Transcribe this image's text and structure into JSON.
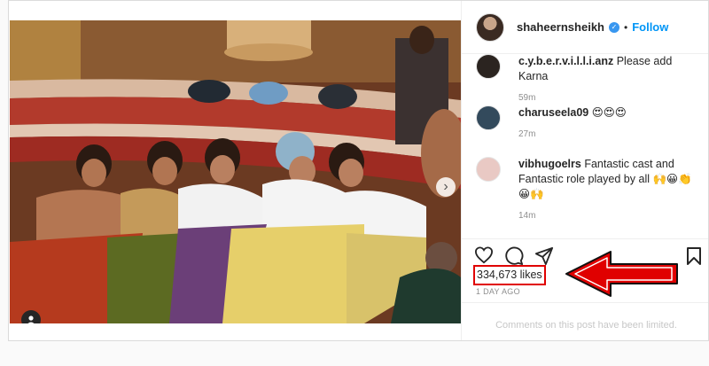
{
  "post": {
    "username": "shaheernsheikh",
    "separator": "•",
    "follow_label": "Follow",
    "verified_glyph": "✓"
  },
  "comments": [
    {
      "username": "c.y.b.e.r.v.i.l.l.i.anz",
      "text": "Please add Karna",
      "time": "59m",
      "avatar_color": "#2b2420"
    },
    {
      "username": "charuseela09",
      "text": "😍😍😍",
      "time": "27m",
      "avatar_color": "#334a5c"
    },
    {
      "username": "vibhugoelrs",
      "text": "Fantastic cast and Fantastic role played by all 🙌😀👏😀🙌",
      "time": "14m",
      "avatar_color": "#e9c9c4"
    }
  ],
  "actions": {
    "icons": [
      "heart-icon",
      "comment-icon",
      "share-icon",
      "bookmark-icon"
    ]
  },
  "likes_text": "334,673 likes",
  "time_ago": "1 DAY AGO",
  "limited_text": "Comments on this post have been limited.",
  "carousel": {
    "count": 4,
    "active": 0
  },
  "colors": {
    "accent": "#0095f6",
    "verified": "#3897f0",
    "highlight_box": "#e00000",
    "arrow_fill": "#e00000"
  }
}
